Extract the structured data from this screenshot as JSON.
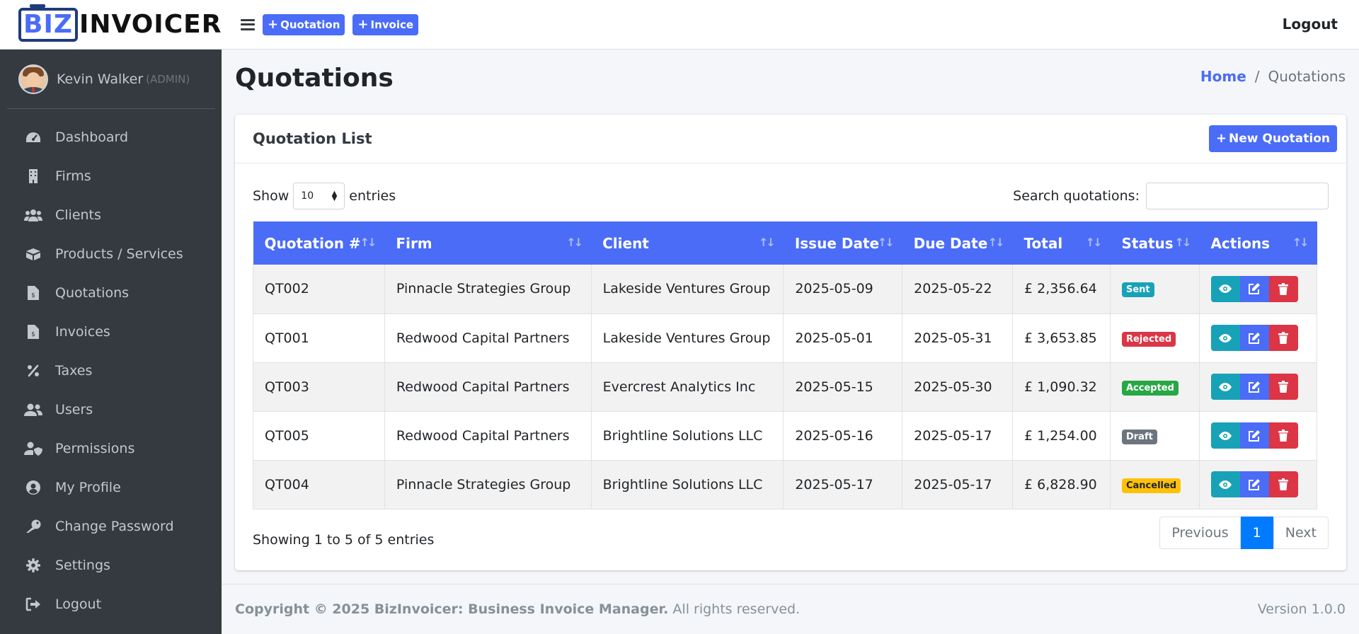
{
  "brand": {
    "logo_biz": "BIZ",
    "logo_rest": "INVOICER"
  },
  "user": {
    "name": "Kevin Walker",
    "role": "(ADMIN)"
  },
  "sidebar": {
    "items": [
      {
        "label": "Dashboard",
        "icon": "dashboard-icon"
      },
      {
        "label": "Firms",
        "icon": "building-icon"
      },
      {
        "label": "Clients",
        "icon": "users-icon"
      },
      {
        "label": "Products / Services",
        "icon": "boxes-icon"
      },
      {
        "label": "Quotations",
        "icon": "file-invoice-icon"
      },
      {
        "label": "Invoices",
        "icon": "file-invoice-dollar-icon"
      },
      {
        "label": "Taxes",
        "icon": "percent-icon"
      },
      {
        "label": "Users",
        "icon": "user-group-icon"
      },
      {
        "label": "Permissions",
        "icon": "user-shield-icon"
      },
      {
        "label": "My Profile",
        "icon": "user-circle-icon"
      },
      {
        "label": "Change Password",
        "icon": "key-icon"
      },
      {
        "label": "Settings",
        "icon": "gear-icon"
      },
      {
        "label": "Logout",
        "icon": "sign-out-icon"
      }
    ]
  },
  "topbar": {
    "quotation_btn": "Quotation",
    "invoice_btn": "Invoice",
    "logout": "Logout"
  },
  "page": {
    "title": "Quotations",
    "breadcrumb_home": "Home",
    "breadcrumb_sep": "/",
    "breadcrumb_current": "Quotations"
  },
  "card": {
    "title": "Quotation List",
    "new_button": "New Quotation"
  },
  "controls": {
    "show_label": "Show",
    "entries_value": "10",
    "entries_label": "entries",
    "search_label": "Search quotations:",
    "search_value": ""
  },
  "table": {
    "headers": [
      "Quotation #",
      "Firm",
      "Client",
      "Issue Date",
      "Due Date",
      "Total",
      "Status",
      "Actions"
    ],
    "rows": [
      {
        "number": "QT002",
        "firm": "Pinnacle Strategies Group",
        "client": "Lakeside Ventures Group",
        "issue": "2025-05-09",
        "due": "2025-05-22",
        "total": "£ 2,356.64",
        "status": "Sent",
        "status_color": "#17a2b8",
        "status_text_color": "#ffffff"
      },
      {
        "number": "QT001",
        "firm": "Redwood Capital Partners",
        "client": "Lakeside Ventures Group",
        "issue": "2025-05-01",
        "due": "2025-05-31",
        "total": "£ 3,653.85",
        "status": "Rejected",
        "status_color": "#dc3545",
        "status_text_color": "#ffffff"
      },
      {
        "number": "QT003",
        "firm": "Redwood Capital Partners",
        "client": "Evercrest Analytics Inc",
        "issue": "2025-05-15",
        "due": "2025-05-30",
        "total": "£ 1,090.32",
        "status": "Accepted",
        "status_color": "#28a745",
        "status_text_color": "#ffffff"
      },
      {
        "number": "QT005",
        "firm": "Redwood Capital Partners",
        "client": "Brightline Solutions LLC",
        "issue": "2025-05-16",
        "due": "2025-05-17",
        "total": "£ 1,254.00",
        "status": "Draft",
        "status_color": "#6c757d",
        "status_text_color": "#ffffff"
      },
      {
        "number": "QT004",
        "firm": "Pinnacle Strategies Group",
        "client": "Brightline Solutions LLC",
        "issue": "2025-05-17",
        "due": "2025-05-17",
        "total": "£ 6,828.90",
        "status": "Cancelled",
        "status_color": "#ffc107",
        "status_text_color": "#212529"
      }
    ]
  },
  "pagination": {
    "info": "Showing 1 to 5 of 5 entries",
    "previous": "Previous",
    "current": "1",
    "next": "Next"
  },
  "footer": {
    "copyright": "Copyright © 2025 BizInvoicer: Business Invoice Manager.",
    "rights": "All rights reserved.",
    "version": "Version 1.0.0"
  },
  "colors": {
    "accent": "#4a6cf7",
    "sidebar_bg": "#343a40"
  }
}
